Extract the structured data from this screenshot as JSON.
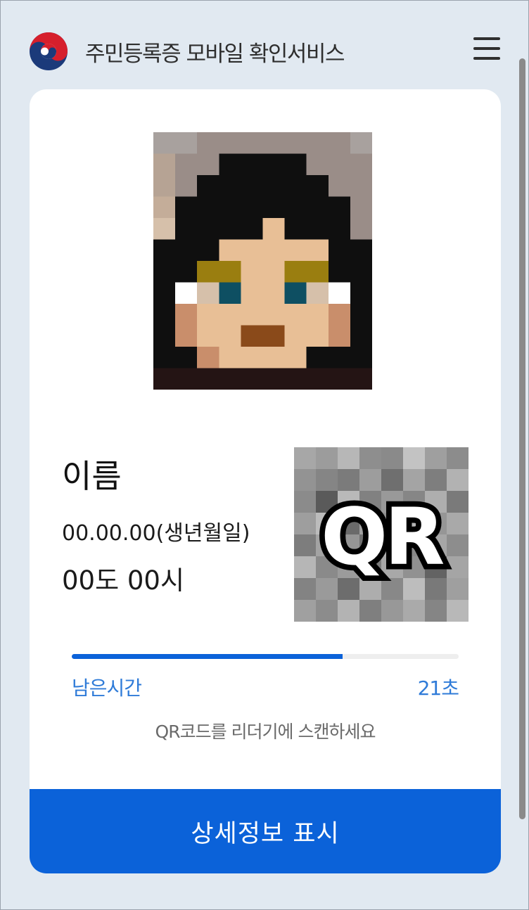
{
  "header": {
    "title": "주민등록증 모바일 확인서비스",
    "emblem_icon": "korea-government-emblem-icon",
    "menu_icon": "hamburger-menu-icon"
  },
  "card": {
    "photo_icon": "pixelated-profile-photo",
    "name": "이름",
    "birth_date": "00.00.00(생년월일)",
    "address": "00도 00시",
    "qr_label": "QR",
    "remaining": {
      "label": "남은시간",
      "value": "21초",
      "progress": 0.7
    },
    "hint": "QR코드를 리더기에 스캔하세요",
    "detail_button": "상세정보 표시"
  },
  "colors": {
    "accent": "#0b62d9",
    "timer_text": "#2f7bd8",
    "background": "#e1e9f1"
  }
}
